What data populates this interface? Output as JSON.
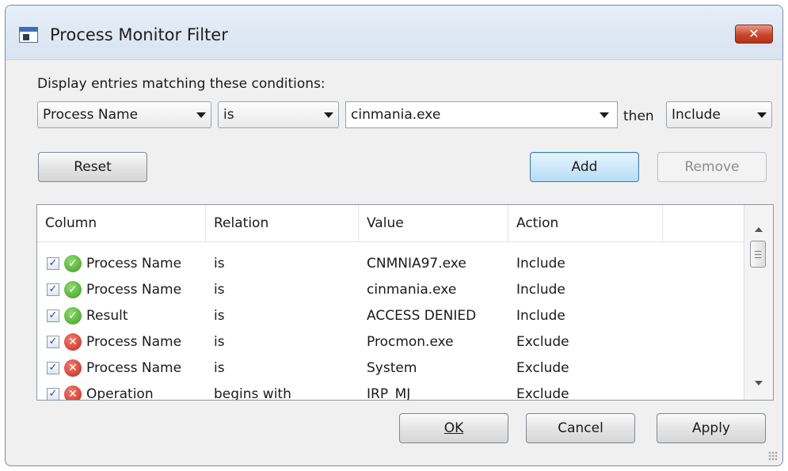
{
  "window": {
    "title": "Process Monitor Filter",
    "close_glyph": "✕"
  },
  "conditions": {
    "label": "Display entries matching these conditions:",
    "column": "Process Name",
    "relation": "is",
    "value": "cinmania.exe",
    "then_label": "then",
    "action": "Include"
  },
  "buttons": {
    "reset": "Reset",
    "add": "Add",
    "remove": "Remove",
    "ok": "OK",
    "cancel": "Cancel",
    "apply": "Apply"
  },
  "list": {
    "columns": [
      "Column",
      "Relation",
      "Value",
      "Action"
    ],
    "rows": [
      {
        "checked": true,
        "status": "include",
        "column": "Process Name",
        "relation": "is",
        "value": "CNMNIA97.exe",
        "action": "Include"
      },
      {
        "checked": true,
        "status": "include",
        "column": "Process Name",
        "relation": "is",
        "value": "cinmania.exe",
        "action": "Include"
      },
      {
        "checked": true,
        "status": "include",
        "column": "Result",
        "relation": "is",
        "value": "ACCESS DENIED",
        "action": "Include"
      },
      {
        "checked": true,
        "status": "exclude",
        "column": "Process Name",
        "relation": "is",
        "value": "Procmon.exe",
        "action": "Exclude"
      },
      {
        "checked": true,
        "status": "exclude",
        "column": "Process Name",
        "relation": "is",
        "value": "System",
        "action": "Exclude"
      },
      {
        "checked": true,
        "status": "exclude",
        "column": "Operation",
        "relation": "begins with",
        "value": "IRP_MJ",
        "action": "Exclude"
      }
    ]
  },
  "icons": {
    "app": "process-monitor-icon",
    "include": "green-check-icon",
    "exclude": "red-x-icon",
    "check_glyph": "✓",
    "include_glyph": "✓",
    "exclude_glyph": "✕"
  },
  "colors": {
    "include": "#3d9b26",
    "exclude": "#c52418",
    "default_button": "#3c7fb1"
  }
}
